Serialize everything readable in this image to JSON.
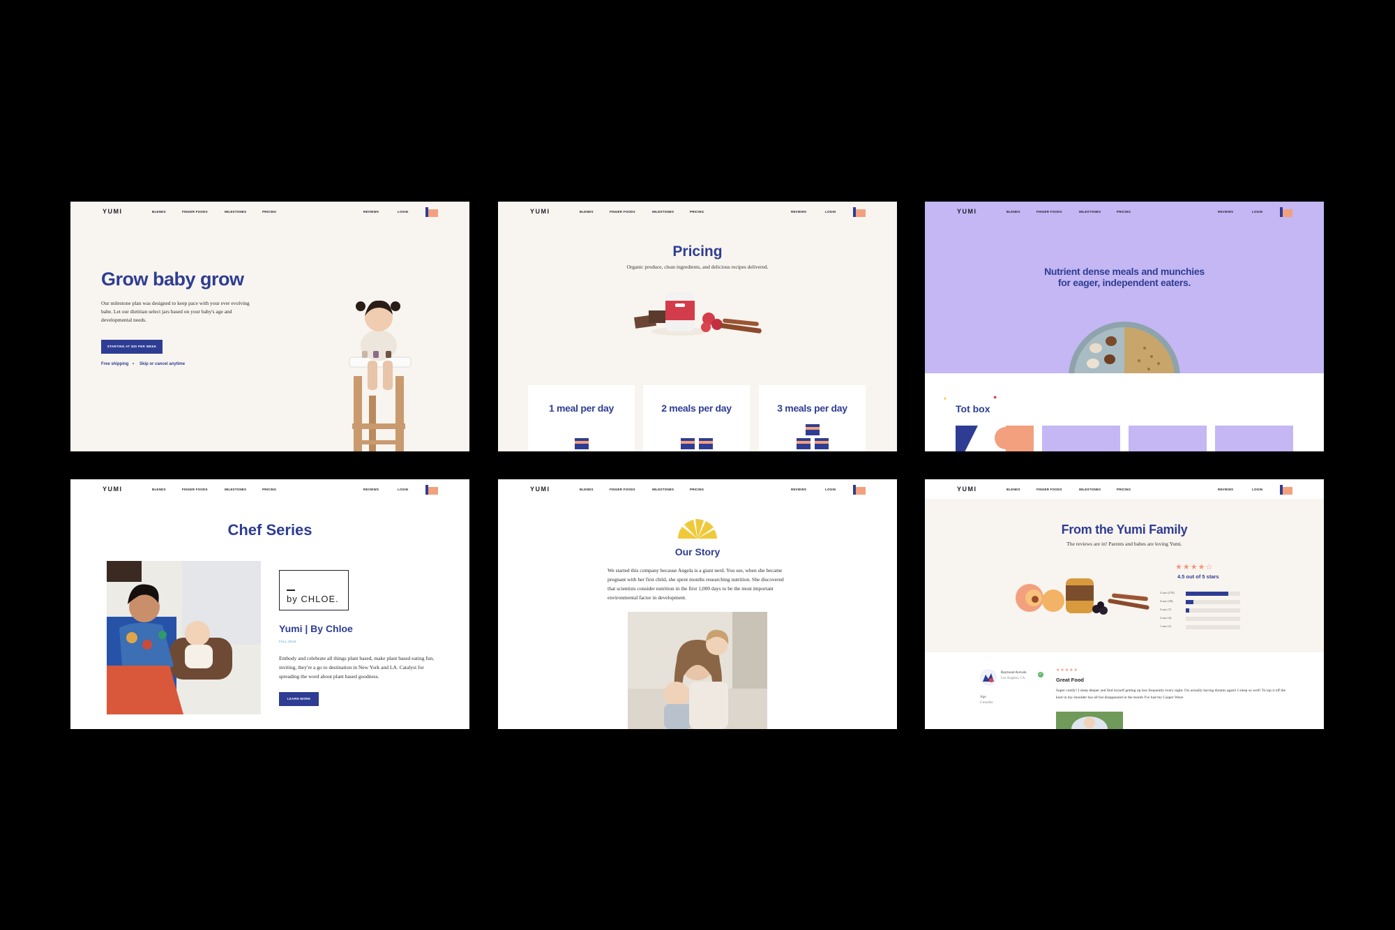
{
  "nav": {
    "logo": "YUMI",
    "links": [
      "BLENDS",
      "FINGER FOODS",
      "MILESTONES",
      "PRICING"
    ],
    "right_links": [
      "REVIEWS",
      "LOGIN"
    ]
  },
  "colors": {
    "brand_blue": "#2e3d93",
    "cream": "#f8f4ef",
    "lavender": "#c4b7f3",
    "peach": "#f3a07e",
    "yellow": "#f0c93a"
  },
  "panel1": {
    "title": "Grow baby grow",
    "body": "Our milestone plan was designed to keep pace with your ever evolving babe. Let our dietitian select jars based on your baby's age and developmental needs.",
    "cta": "STARTING AT $30 PER WEEK",
    "perk1": "Free shipping",
    "bullet": "•",
    "perk2": "Skip or cancel anytime"
  },
  "panel2": {
    "title": "Pricing",
    "subtitle": "Organic produce, clean ingredients, and delicious recipes delivered.",
    "jar_label": "YUMI",
    "plans": [
      "1 meal per day",
      "2 meals per day",
      "3 meals per day"
    ]
  },
  "panel3": {
    "headline_line1": "Nutrient dense meals and munchies",
    "headline_line2": "for eager, independent eaters.",
    "section_title": "Tot box"
  },
  "panel4": {
    "title": "Chef Series",
    "partner_logo": "by CHLOE.",
    "name": "Yumi | By Chloe",
    "season": "FALL 2018",
    "description": "Embody and celebrate all things plant based, make plant based eating fun, inviting, they're a go to destination in New York and LA. Catalyst for spreading the word about plant based goodness.",
    "cta": "LEARN MORE"
  },
  "panel5": {
    "title": "Our Story",
    "story": "We started this company because Angela is a giant nerd. You see, when she became pregnant with her first child, she spent months researching nutrition. She discovered that scientists consider nutrition in the first 1,000 days to be the most important environmental factor in development."
  },
  "panel6": {
    "title": "From the Yumi Family",
    "subtitle": "The reviews are in! Parents and babes are loving Yumi.",
    "stars": "★★★★☆",
    "average": "4.5 out of 5 stars",
    "breakdown": [
      {
        "label": "5 star (276)",
        "fraction": 0.78
      },
      {
        "label": "4 star (30)",
        "fraction": 0.14
      },
      {
        "label": "3 star (7)",
        "fraction": 0.06
      },
      {
        "label": "2 star (4)",
        "fraction": 0.0
      },
      {
        "label": "1 star (1)",
        "fraction": 0.0
      }
    ],
    "review": {
      "name": "Raymond Arevalo",
      "location": "Los Angeles, CA",
      "age_label": "Age:",
      "age_value": "6 months",
      "stars": "★★★★★",
      "title": "Great Food",
      "text": "Super comfy! I sleep deeper and find myself getting up less frequently every night. I'm actually having dreams again! I sleep so well! To top it off the knot in my shoulder has all but disappeared in the month I've had my Casper Wave"
    }
  }
}
